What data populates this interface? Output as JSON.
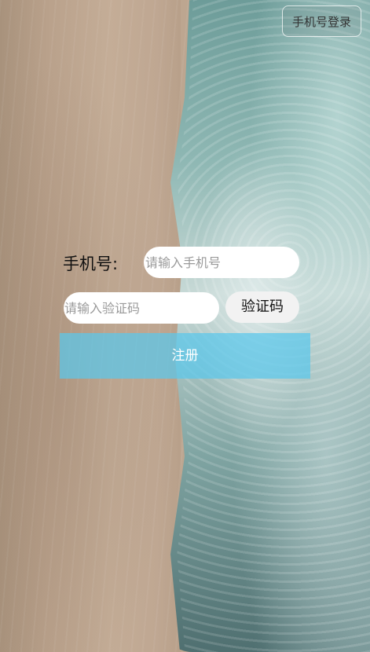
{
  "header": {
    "top_button_label": "手机号登录"
  },
  "form": {
    "phone_label": "手机号:",
    "phone_placeholder": "请输入手机号",
    "phone_value": "",
    "code_placeholder": "请输入验证码",
    "code_value": "",
    "get_code_label": "验证码",
    "register_label": "注册"
  },
  "colors": {
    "register_button": "#5ac8eb",
    "input_background": "#ffffff",
    "code_button_background": "#f2f2f2"
  },
  "background": {
    "scene": "beach-and-waves"
  }
}
